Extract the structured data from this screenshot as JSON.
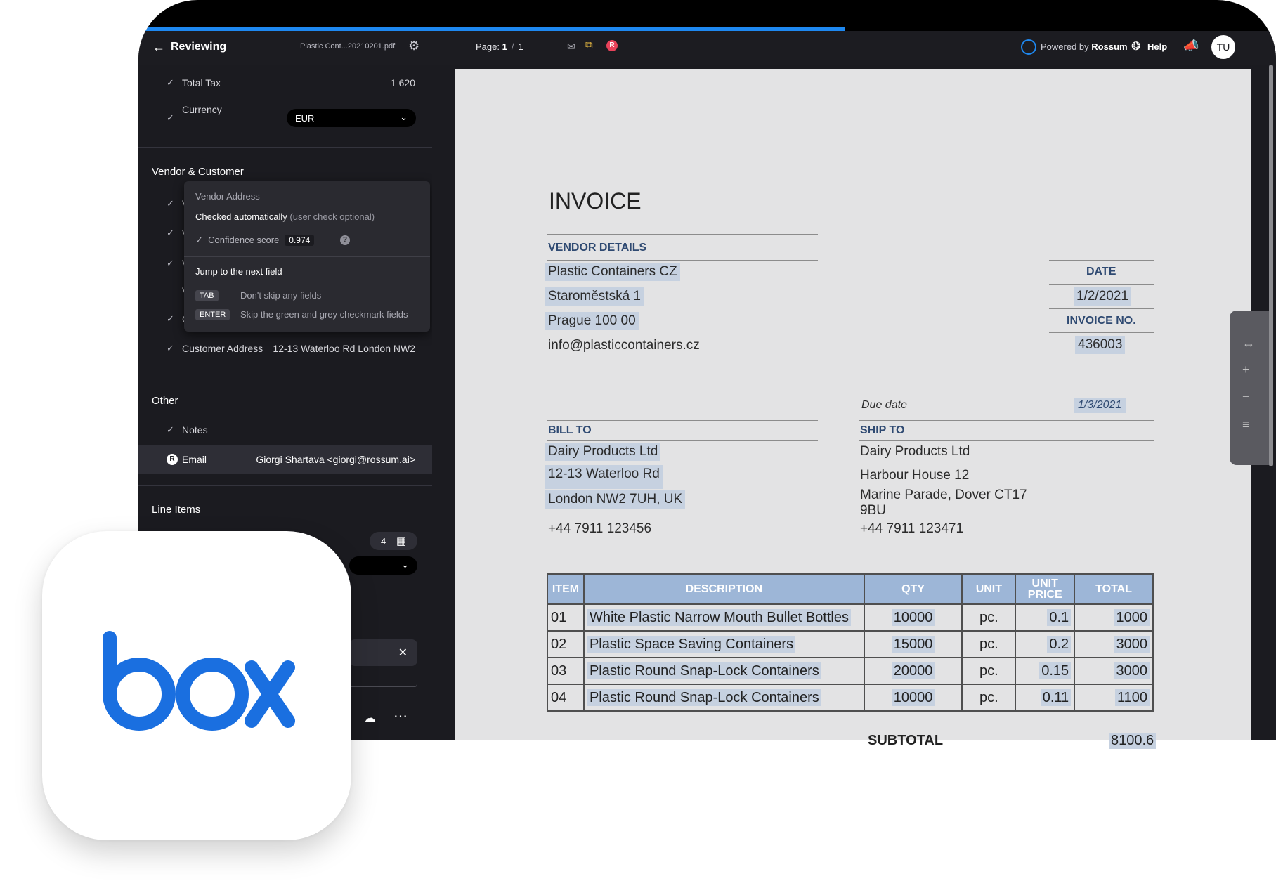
{
  "topbar": {
    "back_icon": "arrow-left-icon",
    "title": "Reviewing",
    "file_name": "Plastic Cont...20210201.pdf",
    "page_label": "Page:",
    "page_current": "1",
    "page_total": "1",
    "powered_prefix": "Powered by",
    "powered_brand": "Rossum",
    "help_label": "Help",
    "avatar_initials": "TU",
    "r_badge": "R"
  },
  "sidebar": {
    "rows": [
      {
        "label": "Total Tax",
        "value": "1 620"
      },
      {
        "label": "Currency",
        "value": "EUR"
      }
    ],
    "vendor_section": "Vendor & Customer",
    "vendor_rows_prefix": [
      "V",
      "V",
      "V",
      "V",
      "C"
    ],
    "customer_address": {
      "label": "Customer Address",
      "value": "12-13 Waterloo Rd London NW2"
    },
    "other_section": "Other",
    "notes_label": "Notes",
    "email": {
      "label": "Email",
      "value": "Giorgi Shartava <giorgi@rossum.ai>",
      "badge": "R"
    },
    "line_items_section": "Line Items",
    "line_items_count": "4"
  },
  "tooltip": {
    "field_name": "Vendor Address",
    "checked": "Checked automatically",
    "checked_note": "(user check optional)",
    "confidence_label": "Confidence score",
    "confidence_value": "0.974",
    "jump_title": "Jump to the next field",
    "tab_key": "TAB",
    "tab_desc": "Don't skip any fields",
    "enter_key": "ENTER",
    "enter_desc": "Skip the green and grey checkmark fields"
  },
  "invoice": {
    "title": "INVOICE",
    "vendor_label": "VENDOR DETAILS",
    "vendor_name": "Plastic Containers CZ",
    "vendor_street": "Staroměstská 1",
    "vendor_city": "Prague 100 00",
    "vendor_email": "info@plasticcontainers.cz",
    "date_label": "DATE",
    "date_value": "1/2/2021",
    "invoice_no_label": "INVOICE NO.",
    "invoice_no_value": "436003",
    "due_label": "Due date",
    "due_value": "1/3/2021",
    "bill_label": "BILL TO",
    "bill_name": "Dairy Products Ltd",
    "bill_street": "12-13 Waterloo Rd",
    "bill_city": "London NW2 7UH, UK",
    "bill_phone": "+44 7911 123456",
    "ship_label": "SHIP TO",
    "ship_name": "Dairy Products Ltd",
    "ship_street": "Harbour House 12",
    "ship_city_1": "Marine Parade, Dover CT17",
    "ship_city_2": "9BU",
    "ship_phone": "+44 7911 123471",
    "columns": [
      "ITEM",
      "DESCRIPTION",
      "QTY",
      "UNIT",
      "UNIT PRICE",
      "TOTAL"
    ],
    "items": [
      {
        "item": "01",
        "desc": "White Plastic Narrow Mouth Bullet Bottles",
        "qty": "10000",
        "unit": "pc.",
        "price": "0.1",
        "total": "1000"
      },
      {
        "item": "02",
        "desc": "Plastic Space Saving Containers",
        "qty": "15000",
        "unit": "pc.",
        "price": "0.2",
        "total": "3000"
      },
      {
        "item": "03",
        "desc": "Plastic Round Snap-Lock Containers",
        "qty": "20000",
        "unit": "pc.",
        "price": "0.15",
        "total": "3000"
      },
      {
        "item": "04",
        "desc": "Plastic Round Snap-Lock Containers",
        "qty": "10000",
        "unit": "pc.",
        "price": "0.11",
        "total": "1100"
      }
    ],
    "subtotal_label": "SUBTOTAL",
    "subtotal_value": "8100.6"
  },
  "box_logo": {
    "text": "box",
    "color": "#1a6fe0"
  },
  "colors": {
    "accent": "#1e88f0",
    "highlight": "#c6d1e0",
    "table_header": "#9db6d7"
  }
}
